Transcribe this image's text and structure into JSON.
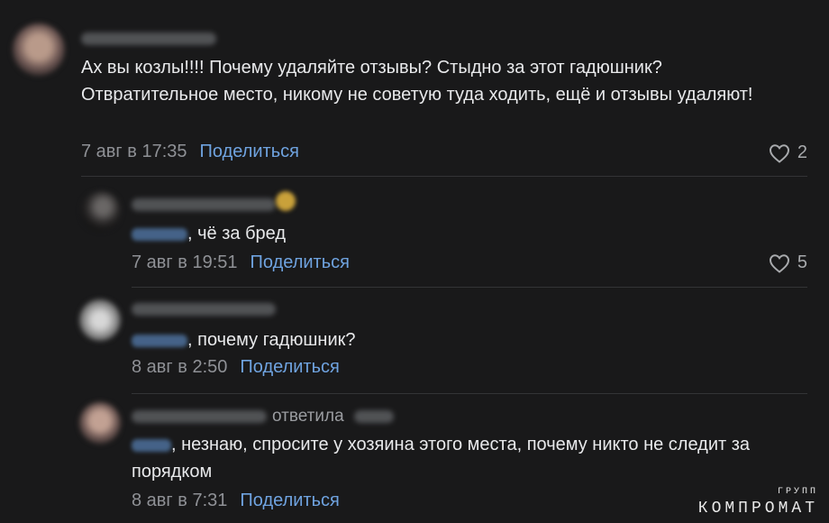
{
  "comments": [
    {
      "text": "Ах вы козлы!!!! Почему удаляйте отзывы? Стыдно за этот гадюшник? Отвратительное место, никому не советую туда ходить, ещё и отзывы удаляют!",
      "date": "7 авг в 17:35",
      "share": "Поделиться",
      "likes": "2"
    },
    {
      "text": ", чё за бред",
      "date": "7 авг в 19:51",
      "share": "Поделиться",
      "likes": "5"
    },
    {
      "text": ", почему гадюшник?",
      "date": "8 авг в 2:50",
      "share": "Поделиться"
    },
    {
      "replied_label": "ответила",
      "text": ", незнаю, спросите у хозяина этого места, почему никто не следит за порядком",
      "date": "8 авг в 7:31",
      "share": "Поделиться"
    }
  ],
  "watermark": {
    "top": "ГРУПП",
    "main": "КОМПРОМАТ"
  },
  "colors": {
    "background": "#19191a",
    "link": "#6fa3e0",
    "meta": "#8f9196"
  }
}
